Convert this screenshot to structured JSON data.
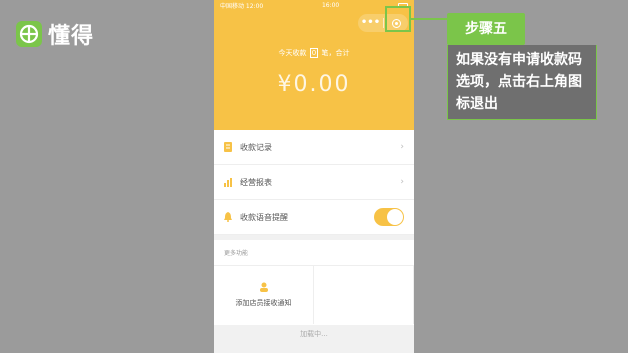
{
  "brand": {
    "name": "懂得"
  },
  "status_bar": {
    "left": "中国移动 12:00",
    "center": "16:00"
  },
  "miniapp": {
    "capsule_dots": "•••",
    "summary_prefix": "今天收款",
    "summary_count": "0",
    "summary_suffix": "笔，合计",
    "amount": "¥0.00"
  },
  "menu": [
    {
      "label": "收款记录",
      "icon": "receipt-icon"
    },
    {
      "label": "经营报表",
      "icon": "chart-icon"
    },
    {
      "label": "收款语音提醒",
      "icon": "bell-icon",
      "toggle_on": true
    }
  ],
  "more": {
    "title": "更多功能",
    "cells": [
      {
        "label": "添加店员接收通知",
        "icon": "staff-icon"
      }
    ]
  },
  "loading": "加载中...",
  "annotation": {
    "step": "步骤五",
    "text": "如果没有申请收款码选项，点击右上角图标退出"
  },
  "colors": {
    "accent": "#f7c246",
    "guide": "#7bc54a",
    "callout_bg": "#6f6f6f"
  }
}
